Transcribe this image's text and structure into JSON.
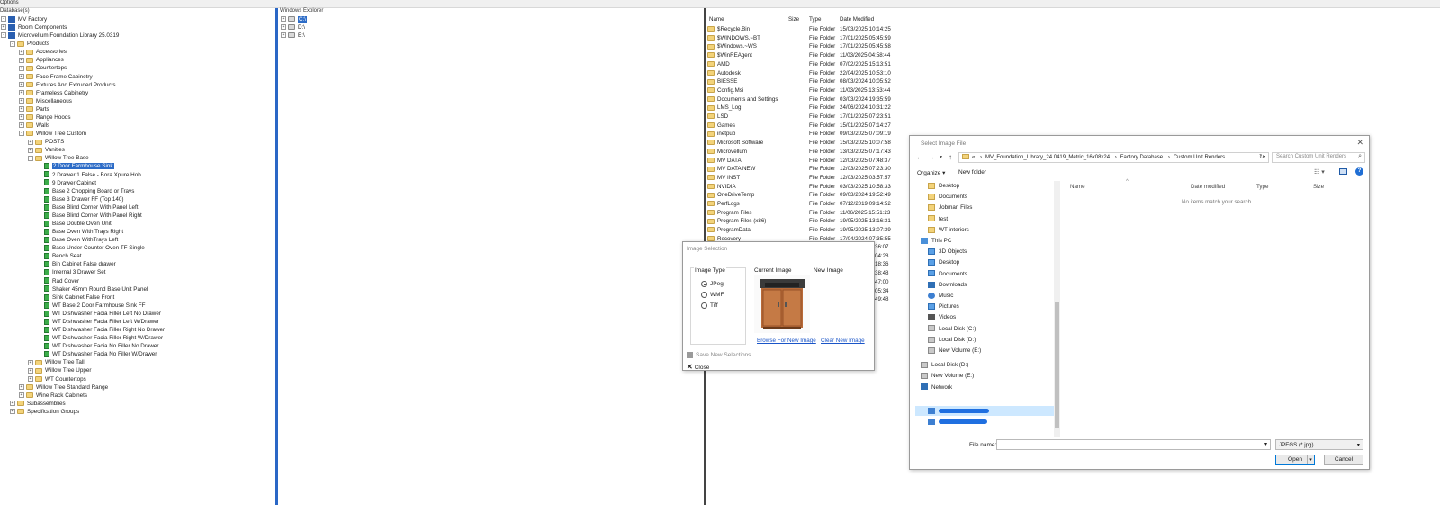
{
  "app": {
    "menu_label": "Options"
  },
  "left_panel": {
    "header": "Database(s)",
    "rows": [
      {
        "label": "MV Factory",
        "level": 0,
        "icon": "db",
        "exp": "-"
      },
      {
        "label": "Room Components",
        "level": 0,
        "icon": "db",
        "exp": "+"
      },
      {
        "label": "Microvellum Foundation Library 25.0319",
        "level": 0,
        "icon": "db",
        "exp": "-"
      },
      {
        "label": "Products",
        "level": 1,
        "icon": "folder",
        "exp": "-"
      },
      {
        "label": "Accessories",
        "level": 2,
        "icon": "folder",
        "exp": "+"
      },
      {
        "label": "Appliances",
        "level": 2,
        "icon": "folder",
        "exp": "+"
      },
      {
        "label": "Countertops",
        "level": 2,
        "icon": "folder",
        "exp": "+"
      },
      {
        "label": "Face Frame Cabinetry",
        "level": 2,
        "icon": "folder",
        "exp": "+"
      },
      {
        "label": "Fixtures And Extruded Products",
        "level": 2,
        "icon": "folder",
        "exp": "+"
      },
      {
        "label": "Frameless Cabinetry",
        "level": 2,
        "icon": "folder",
        "exp": "+"
      },
      {
        "label": "Miscellaneous",
        "level": 2,
        "icon": "folder",
        "exp": "+"
      },
      {
        "label": "Parts",
        "level": 2,
        "icon": "folder",
        "exp": "+"
      },
      {
        "label": "Range Hoods",
        "level": 2,
        "icon": "folder",
        "exp": "+"
      },
      {
        "label": "Walls",
        "level": 2,
        "icon": "folder",
        "exp": "+"
      },
      {
        "label": "Willow Tree Custom",
        "level": 2,
        "icon": "folder",
        "exp": "-"
      },
      {
        "label": "POSTS",
        "level": 3,
        "icon": "folder",
        "exp": "+"
      },
      {
        "label": "Vanities",
        "level": 3,
        "icon": "folder",
        "exp": "+"
      },
      {
        "label": "Willow Tree Base",
        "level": 3,
        "icon": "folder",
        "exp": "-"
      },
      {
        "label": "2 Door Farmhouse Sink",
        "level": 4,
        "icon": "doc",
        "exp": "",
        "selected": true
      },
      {
        "label": "2 Drawer 1 False - Bora Xpure Hob",
        "level": 4,
        "icon": "doc",
        "exp": ""
      },
      {
        "label": "9 Drawer Cabinet",
        "level": 4,
        "icon": "doc",
        "exp": ""
      },
      {
        "label": "Base 2 Chopping Board or Trays",
        "level": 4,
        "icon": "doc",
        "exp": ""
      },
      {
        "label": "Base 3 Drawer FF (Top 140)",
        "level": 4,
        "icon": "doc",
        "exp": ""
      },
      {
        "label": "Base Blind Corner With Panel Left",
        "level": 4,
        "icon": "doc",
        "exp": ""
      },
      {
        "label": "Base Blind Corner With Panel Right",
        "level": 4,
        "icon": "doc",
        "exp": ""
      },
      {
        "label": "Base Double Oven Unit",
        "level": 4,
        "icon": "doc",
        "exp": ""
      },
      {
        "label": "Base Oven With Trays Right",
        "level": 4,
        "icon": "doc",
        "exp": ""
      },
      {
        "label": "Base Oven WithTrays Left",
        "level": 4,
        "icon": "doc",
        "exp": ""
      },
      {
        "label": "Base Under Counter Oven TF Single",
        "level": 4,
        "icon": "doc",
        "exp": ""
      },
      {
        "label": "Bench Seat",
        "level": 4,
        "icon": "doc",
        "exp": ""
      },
      {
        "label": "Bin Cabinet False drawer",
        "level": 4,
        "icon": "doc",
        "exp": ""
      },
      {
        "label": "Internal 3 Drawer Set",
        "level": 4,
        "icon": "doc",
        "exp": ""
      },
      {
        "label": "Rad Cover",
        "level": 4,
        "icon": "doc",
        "exp": ""
      },
      {
        "label": "Shaker 45mm Round Base Unit Panel",
        "level": 4,
        "icon": "doc",
        "exp": ""
      },
      {
        "label": "Sink Cabinet False Front",
        "level": 4,
        "icon": "doc",
        "exp": ""
      },
      {
        "label": "WT Base 2 Door Farmhouse Sink FF",
        "level": 4,
        "icon": "doc",
        "exp": ""
      },
      {
        "label": "WT Dishwasher Facia Filler Left No Drawer",
        "level": 4,
        "icon": "doc",
        "exp": ""
      },
      {
        "label": "WT Dishwasher Facia Filler Left W/Drawer",
        "level": 4,
        "icon": "doc",
        "exp": ""
      },
      {
        "label": "WT Dishwasher Facia Filler Right No Drawer",
        "level": 4,
        "icon": "doc",
        "exp": ""
      },
      {
        "label": "WT Dishwasher Facia Filler Right W/Drawer",
        "level": 4,
        "icon": "doc",
        "exp": ""
      },
      {
        "label": "WT Dishwasher Facia No Filler No Drawer",
        "level": 4,
        "icon": "doc",
        "exp": ""
      },
      {
        "label": "WT Dishwasher Facia No Filler W/Drawer",
        "level": 4,
        "icon": "doc",
        "exp": ""
      },
      {
        "label": "Willow Tree Tall",
        "level": 3,
        "icon": "folder",
        "exp": "+"
      },
      {
        "label": "Willow Tree Upper",
        "level": 3,
        "icon": "folder",
        "exp": "+"
      },
      {
        "label": "WT Countertops",
        "level": 3,
        "icon": "folder",
        "exp": "+"
      },
      {
        "label": "Willow Tree Standard Range",
        "level": 2,
        "icon": "folder",
        "exp": "+"
      },
      {
        "label": "Wine Rack Cabinets",
        "level": 2,
        "icon": "folder",
        "exp": "+"
      },
      {
        "label": "Subassemblies",
        "level": 1,
        "icon": "folder",
        "exp": "+"
      },
      {
        "label": "Specification Groups",
        "level": 1,
        "icon": "folder",
        "exp": "+"
      }
    ]
  },
  "explorer_panel": {
    "header": "Windows Explorer",
    "drives": [
      {
        "label": "C:\\",
        "selected": true
      },
      {
        "label": "D:\\"
      },
      {
        "label": "E:\\"
      }
    ]
  },
  "file_list": {
    "columns": [
      "Name",
      "Size",
      "Type",
      "Date Modified"
    ],
    "rows": [
      [
        "$Recycle.Bin",
        "",
        "File Folder",
        "15/03/2025 10:14:25"
      ],
      [
        "$WINDOWS.~BT",
        "",
        "File Folder",
        "17/01/2025 05:45:59"
      ],
      [
        "$Windows.~WS",
        "",
        "File Folder",
        "17/01/2025 05:45:58"
      ],
      [
        "$WinREAgent",
        "",
        "File Folder",
        "11/03/2025 04:58:44"
      ],
      [
        "AMD",
        "",
        "File Folder",
        "07/02/2025 15:13:51"
      ],
      [
        "Autodesk",
        "",
        "File Folder",
        "22/04/2025 10:53:10"
      ],
      [
        "BIESSE",
        "",
        "File Folder",
        "08/03/2024 10:05:52"
      ],
      [
        "Config.Msi",
        "",
        "File Folder",
        "11/03/2025 13:53:44"
      ],
      [
        "Documents and Settings",
        "",
        "File Folder",
        "03/03/2024 19:35:59"
      ],
      [
        "LMS_Log",
        "",
        "File Folder",
        "24/06/2024 10:31:22"
      ],
      [
        "LSD",
        "",
        "File Folder",
        "17/01/2025 07:23:51"
      ],
      [
        "Games",
        "",
        "File Folder",
        "15/01/2025 07:14:27"
      ],
      [
        "inetpub",
        "",
        "File Folder",
        "09/03/2025 07:09:19"
      ],
      [
        "Microsoft Software",
        "",
        "File Folder",
        "15/03/2025 10:07:58"
      ],
      [
        "Microvellum",
        "",
        "File Folder",
        "13/03/2025 07:17:43"
      ],
      [
        "MV DATA",
        "",
        "File Folder",
        "12/03/2025 07:48:37"
      ],
      [
        "MV DATA NEW",
        "",
        "File Folder",
        "12/03/2025 07:23:30"
      ],
      [
        "MV INST",
        "",
        "File Folder",
        "12/03/2025 03:57:57"
      ],
      [
        "NVIDIA",
        "",
        "File Folder",
        "03/03/2025 10:58:33"
      ],
      [
        "OneDriveTemp",
        "",
        "File Folder",
        "09/03/2024 19:52:49"
      ],
      [
        "PerfLogs",
        "",
        "File Folder",
        "07/12/2019 09:14:52"
      ],
      [
        "Program Files",
        "",
        "File Folder",
        "11/06/2025 15:51:23"
      ],
      [
        "Program Files (x86)",
        "",
        "File Folder",
        "19/05/2025 13:16:31"
      ],
      [
        "ProgramData",
        "",
        "File Folder",
        "19/05/2025 13:07:39"
      ],
      [
        "Recovery",
        "",
        "File Folder",
        "17/04/2024 07:35:55"
      ]
    ],
    "partial_times": [
      "36:07",
      "04:28",
      "18:36",
      "38:48",
      "47:00",
      "05:34",
      "49:48"
    ]
  },
  "image_dialog": {
    "title": "Image Selection",
    "image_type_label": "Image Type",
    "options": [
      "JPeg",
      "WMF",
      "Tiff"
    ],
    "selected_option": "JPeg",
    "current_label": "Current Image",
    "new_label": "New Image",
    "browse_link": "Browse For New Image",
    "clear_link": "Clear New Image",
    "save_label": "Save New Selections",
    "close_label": "Close"
  },
  "file_dialog": {
    "title": "Select Image File",
    "crumbs": [
      "«",
      "MV_Foundation_Library_24.0419_Metric_16x08x24",
      "Factory Database",
      "Custom Unit Renders"
    ],
    "search_placeholder": "Search Custom Unit Renders",
    "organize_label": "Organize ▾",
    "new_folder_label": "New folder",
    "columns": [
      "Name",
      "Date modified",
      "Type",
      "Size"
    ],
    "empty_text": "No items match your search.",
    "nav_items": [
      {
        "label": "Desktop",
        "icon": "folder-yellow",
        "indent": 1
      },
      {
        "label": "Documents",
        "icon": "folder-yellow",
        "indent": 1
      },
      {
        "label": "Jobman Files",
        "icon": "folder-yellow",
        "indent": 1
      },
      {
        "label": "test",
        "icon": "folder-yellow",
        "indent": 1
      },
      {
        "label": "WT interiors",
        "icon": "folder-yellow",
        "indent": 1
      },
      {
        "label": "This PC",
        "icon": "pc",
        "indent": 0
      },
      {
        "label": "3D Objects",
        "icon": "folder-blue",
        "indent": 1
      },
      {
        "label": "Desktop",
        "icon": "folder-blue",
        "indent": 1
      },
      {
        "label": "Documents",
        "icon": "folder-blue",
        "indent": 1
      },
      {
        "label": "Downloads",
        "icon": "download",
        "indent": 1
      },
      {
        "label": "Music",
        "icon": "music",
        "indent": 1
      },
      {
        "label": "Pictures",
        "icon": "folder-blue",
        "indent": 1
      },
      {
        "label": "Videos",
        "icon": "video",
        "indent": 1
      },
      {
        "label": "Local Disk (C:)",
        "icon": "disk",
        "indent": 1
      },
      {
        "label": "Local Disk (D:)",
        "icon": "disk",
        "indent": 1
      },
      {
        "label": "New Volume (E:)",
        "icon": "disk",
        "indent": 1
      },
      {
        "label": "Local Disk (D:)",
        "icon": "disk",
        "indent": 0
      },
      {
        "label": "New Volume (E:)",
        "icon": "disk",
        "indent": 0
      },
      {
        "label": "Network",
        "icon": "network",
        "indent": 0
      }
    ],
    "filename_label": "File name:",
    "filetype_value": "JPEGS (*.jpg)",
    "open_label": "Open",
    "cancel_label": "Cancel"
  },
  "colors": {
    "accent": "#2a67c6",
    "selected": "#2d6cc7",
    "folder": "#f3d37a",
    "doc": "#3cad4a",
    "link": "#1a55c8"
  }
}
